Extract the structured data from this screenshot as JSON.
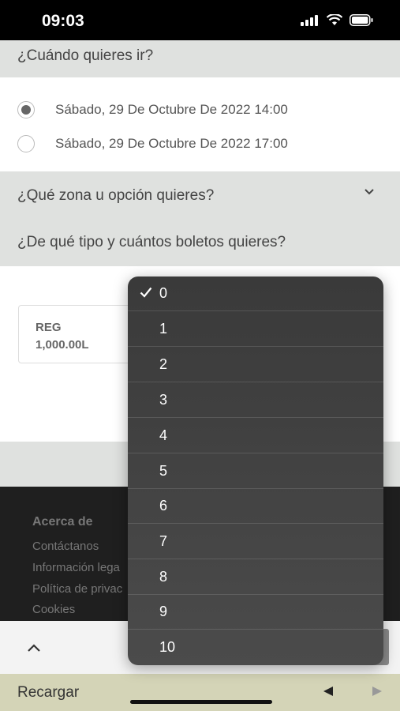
{
  "status_bar": {
    "time": "09:03"
  },
  "when_section": {
    "title": "¿Cuándo quieres ir?",
    "options": [
      {
        "label": "Sábado, 29 De Octubre De 2022 14:00",
        "selected": true
      },
      {
        "label": "Sábado, 29 De Octubre De 2022 17:00",
        "selected": false
      }
    ]
  },
  "zone_section": {
    "title": "¿Qué zona u opción quieres?",
    "chevron_icon": "chevron-down-icon"
  },
  "tickets_section": {
    "title": "¿De qué tipo y cuántos boletos quieres?",
    "ticket": {
      "type": "REG",
      "price": "1,000.00L"
    }
  },
  "dropdown": {
    "selected": "0",
    "options": [
      "0",
      "1",
      "2",
      "3",
      "4",
      "5",
      "6",
      "7",
      "8",
      "9",
      "10"
    ]
  },
  "footer": {
    "title": "Acerca de",
    "links": [
      "Contáctanos",
      "Información lega",
      "Política de privac",
      "Cookies"
    ]
  },
  "browser": {
    "reload_label": "Recargar"
  },
  "colors": {
    "dropdown_bg": "#3f3f3f",
    "footer_bg": "#1f1f1f",
    "browser_bar": "#d4d4b7"
  }
}
